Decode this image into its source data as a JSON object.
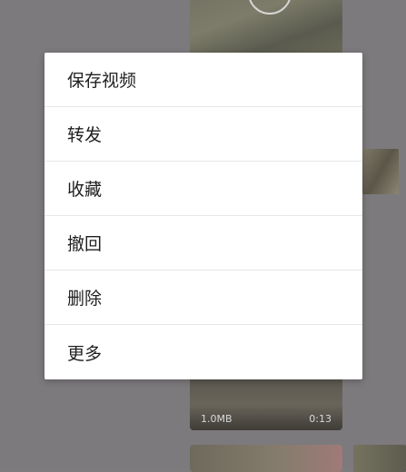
{
  "menu": {
    "items": [
      {
        "label": "保存视频"
      },
      {
        "label": "转发"
      },
      {
        "label": "收藏"
      },
      {
        "label": "撤回"
      },
      {
        "label": "删除"
      },
      {
        "label": "更多"
      }
    ]
  },
  "background_video": {
    "size": "1.0MB",
    "duration": "0:13"
  },
  "colors": {
    "overlay": "#7c7a7c",
    "menu_bg": "#ffffff",
    "menu_text": "#1f1f1f",
    "divider": "#e6e6e6"
  }
}
